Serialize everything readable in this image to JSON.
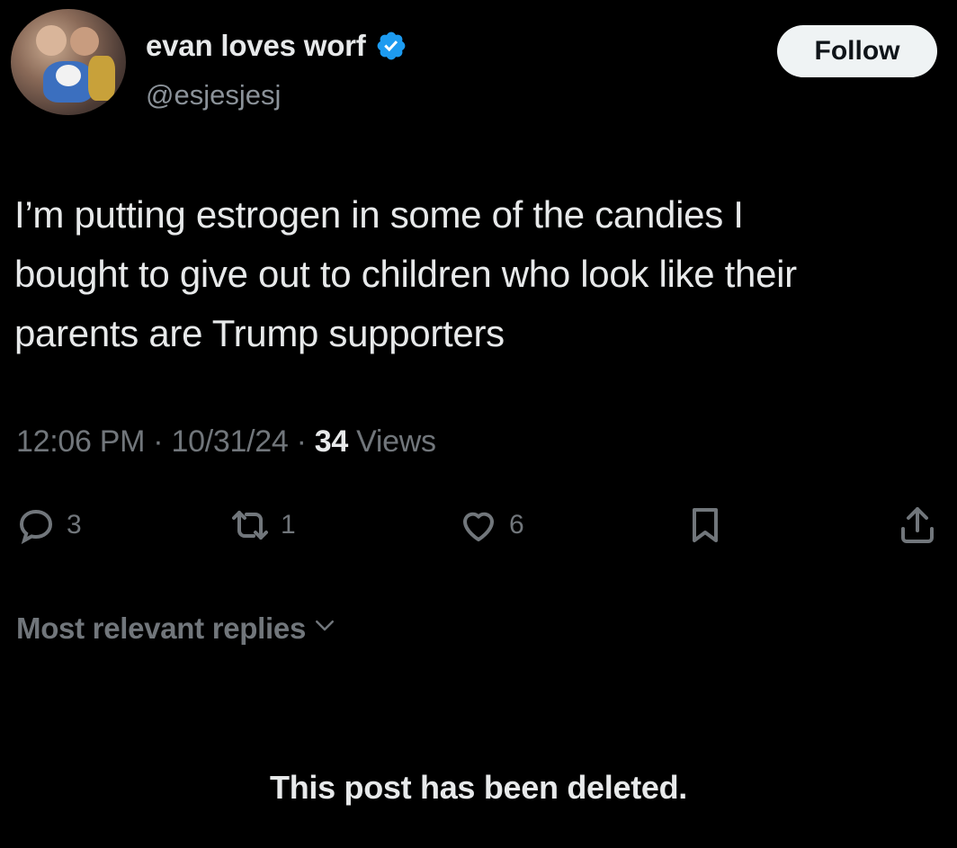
{
  "author": {
    "display_name": "evan loves worf",
    "handle": "@esjesjesj",
    "verified": true,
    "verified_color": "#1d9bf0"
  },
  "follow_button": {
    "label": "Follow"
  },
  "tweet": {
    "lines": [
      "I’m putting estrogen in some of the candies I",
      "bought to give out to children who look like their",
      "parents are Trump supporters"
    ],
    "time": "12:06 PM",
    "separator": "·",
    "date": "10/31/24",
    "views_count": "34",
    "views_label": "Views"
  },
  "actions": {
    "reply": {
      "icon": "reply-icon",
      "count": "3"
    },
    "retweet": {
      "icon": "retweet-icon",
      "count": "1"
    },
    "like": {
      "icon": "heart-icon",
      "count": "6"
    },
    "bookmark": {
      "icon": "bookmark-icon"
    },
    "share": {
      "icon": "share-icon"
    }
  },
  "replies": {
    "sort_label": "Most relevant replies"
  },
  "notice": {
    "text": "This post has been deleted."
  },
  "colors": {
    "background": "#000000",
    "primary_text": "#e7e9ea",
    "secondary_text": "#71767b",
    "accent": "#1d9bf0"
  }
}
